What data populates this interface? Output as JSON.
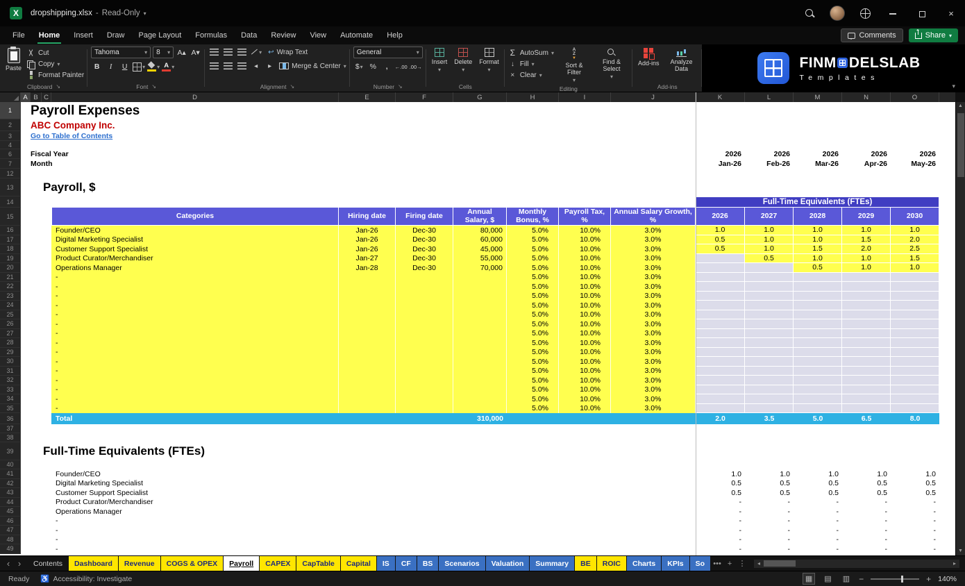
{
  "titlebar": {
    "filename": "dropshipping.xlsx",
    "separator": "-",
    "mode": "Read-Only"
  },
  "menubar": {
    "items": [
      "File",
      "Home",
      "Insert",
      "Draw",
      "Page Layout",
      "Formulas",
      "Data",
      "Review",
      "View",
      "Automate",
      "Help"
    ],
    "active_index": 1,
    "comments_label": "Comments",
    "share_label": "Share"
  },
  "ribbon": {
    "clipboard": {
      "label": "Clipboard",
      "paste": "Paste",
      "cut": "Cut",
      "copy": "Copy",
      "format_painter": "Format Painter"
    },
    "font": {
      "label": "Font",
      "name": "Tahoma",
      "size": "8",
      "bold": "B",
      "italic": "I",
      "underline": "U",
      "grow": "A▴",
      "shrink": "A▾"
    },
    "alignment": {
      "label": "Alignment",
      "wrap_text": "Wrap Text",
      "merge_center": "Merge & Center"
    },
    "number": {
      "label": "Number",
      "format": "General",
      "currency": "$",
      "percent": "%",
      "comma": ",",
      "inc_decimal": "←.00",
      "dec_decimal": ".00→"
    },
    "cells": {
      "label": "Cells",
      "insert": "Insert",
      "delete": "Delete",
      "format": "Format"
    },
    "editing": {
      "label": "Editing",
      "autosum": "AutoSum",
      "fill": "Fill",
      "clear": "Clear",
      "sort_filter": "Sort & Filter",
      "find_select": "Find & Select"
    },
    "addins": {
      "label": "Add-ins",
      "addins_btn": "Add-ins",
      "analyze": "Analyze Data"
    },
    "brand": {
      "pre": "FINM",
      "post": "DELSLAB",
      "subtitle": "Templates"
    }
  },
  "grid": {
    "column_letters": [
      "A",
      "B",
      "C",
      "D",
      "E",
      "F",
      "G",
      "H",
      "I",
      "J",
      "K",
      "L",
      "M",
      "N",
      "O"
    ],
    "visible_row_numbers": [
      "1",
      "2",
      "3",
      "4",
      "6",
      "7",
      "12",
      "13",
      "14",
      "15",
      "16",
      "17",
      "18",
      "19",
      "20",
      "21",
      "22",
      "23",
      "24",
      "25",
      "26",
      "27",
      "28",
      "29",
      "30",
      "31",
      "32",
      "33",
      "34",
      "35",
      "36",
      "37",
      "38",
      "39",
      "40",
      "41",
      "42",
      "43",
      "44",
      "45",
      "46",
      "47",
      "48",
      "49"
    ],
    "title": "Payroll Expenses",
    "company": "ABC Company Inc.",
    "toc_link": "Go to Table of Contents",
    "fiscal_year_label": "Fiscal Year",
    "month_label": "Month",
    "fiscal_years": [
      "2026",
      "2026",
      "2026",
      "2026",
      "2026"
    ],
    "months": [
      "Jan-26",
      "Feb-26",
      "Mar-26",
      "Apr-26",
      "May-26"
    ],
    "payroll_section_title": "Payroll, $",
    "fte_banner": "Full-Time Equivalents (FTEs)",
    "table": {
      "headers": {
        "categories": "Categories",
        "hiring": "Hiring date",
        "firing": "Firing date",
        "salary": "Annual Salary, $",
        "bonus": "Monthly Bonus, %",
        "tax": "Payroll Tax, %",
        "growth": "Annual Salary Growth, %",
        "years": [
          "2026",
          "2027",
          "2028",
          "2029",
          "2030"
        ]
      },
      "rows": [
        {
          "category": "Founder/CEO",
          "hiring": "Jan-26",
          "firing": "Dec-30",
          "salary": "80,000",
          "bonus": "5.0%",
          "tax": "10.0%",
          "growth": "3.0%",
          "ftes": [
            "1.0",
            "1.0",
            "1.0",
            "1.0",
            "1.0"
          ]
        },
        {
          "category": "Digital Marketing Specialist",
          "hiring": "Jan-26",
          "firing": "Dec-30",
          "salary": "60,000",
          "bonus": "5.0%",
          "tax": "10.0%",
          "growth": "3.0%",
          "ftes": [
            "0.5",
            "1.0",
            "1.0",
            "1.5",
            "2.0"
          ]
        },
        {
          "category": "Customer Support Specialist",
          "hiring": "Jan-26",
          "firing": "Dec-30",
          "salary": "45,000",
          "bonus": "5.0%",
          "tax": "10.0%",
          "growth": "3.0%",
          "ftes": [
            "0.5",
            "1.0",
            "1.5",
            "2.0",
            "2.5"
          ]
        },
        {
          "category": "Product Curator/Merchandiser",
          "hiring": "Jan-27",
          "firing": "Dec-30",
          "salary": "55,000",
          "bonus": "5.0%",
          "tax": "10.0%",
          "growth": "3.0%",
          "ftes": [
            "",
            "0.5",
            "1.0",
            "1.0",
            "1.5"
          ]
        },
        {
          "category": "Operations Manager",
          "hiring": "Jan-28",
          "firing": "Dec-30",
          "salary": "70,000",
          "bonus": "5.0%",
          "tax": "10.0%",
          "growth": "3.0%",
          "ftes": [
            "",
            "",
            "0.5",
            "1.0",
            "1.0"
          ]
        },
        {
          "category": "-",
          "hiring": "",
          "firing": "",
          "salary": "",
          "bonus": "5.0%",
          "tax": "10.0%",
          "growth": "3.0%",
          "ftes": [
            "",
            "",
            "",
            "",
            ""
          ]
        },
        {
          "category": "-",
          "hiring": "",
          "firing": "",
          "salary": "",
          "bonus": "5.0%",
          "tax": "10.0%",
          "growth": "3.0%",
          "ftes": [
            "",
            "",
            "",
            "",
            ""
          ]
        },
        {
          "category": "-",
          "hiring": "",
          "firing": "",
          "salary": "",
          "bonus": "5.0%",
          "tax": "10.0%",
          "growth": "3.0%",
          "ftes": [
            "",
            "",
            "",
            "",
            ""
          ]
        },
        {
          "category": "-",
          "hiring": "",
          "firing": "",
          "salary": "",
          "bonus": "5.0%",
          "tax": "10.0%",
          "growth": "3.0%",
          "ftes": [
            "",
            "",
            "",
            "",
            ""
          ]
        },
        {
          "category": "-",
          "hiring": "",
          "firing": "",
          "salary": "",
          "bonus": "5.0%",
          "tax": "10.0%",
          "growth": "3.0%",
          "ftes": [
            "",
            "",
            "",
            "",
            ""
          ]
        },
        {
          "category": "-",
          "hiring": "",
          "firing": "",
          "salary": "",
          "bonus": "5.0%",
          "tax": "10.0%",
          "growth": "3.0%",
          "ftes": [
            "",
            "",
            "",
            "",
            ""
          ]
        },
        {
          "category": "-",
          "hiring": "",
          "firing": "",
          "salary": "",
          "bonus": "5.0%",
          "tax": "10.0%",
          "growth": "3.0%",
          "ftes": [
            "",
            "",
            "",
            "",
            ""
          ]
        },
        {
          "category": "-",
          "hiring": "",
          "firing": "",
          "salary": "",
          "bonus": "5.0%",
          "tax": "10.0%",
          "growth": "3.0%",
          "ftes": [
            "",
            "",
            "",
            "",
            ""
          ]
        },
        {
          "category": "-",
          "hiring": "",
          "firing": "",
          "salary": "",
          "bonus": "5.0%",
          "tax": "10.0%",
          "growth": "3.0%",
          "ftes": [
            "",
            "",
            "",
            "",
            ""
          ]
        },
        {
          "category": "-",
          "hiring": "",
          "firing": "",
          "salary": "",
          "bonus": "5.0%",
          "tax": "10.0%",
          "growth": "3.0%",
          "ftes": [
            "",
            "",
            "",
            "",
            ""
          ]
        },
        {
          "category": "-",
          "hiring": "",
          "firing": "",
          "salary": "",
          "bonus": "5.0%",
          "tax": "10.0%",
          "growth": "3.0%",
          "ftes": [
            "",
            "",
            "",
            "",
            ""
          ]
        },
        {
          "category": "-",
          "hiring": "",
          "firing": "",
          "salary": "",
          "bonus": "5.0%",
          "tax": "10.0%",
          "growth": "3.0%",
          "ftes": [
            "",
            "",
            "",
            "",
            ""
          ]
        },
        {
          "category": "-",
          "hiring": "",
          "firing": "",
          "salary": "",
          "bonus": "5.0%",
          "tax": "10.0%",
          "growth": "3.0%",
          "ftes": [
            "",
            "",
            "",
            "",
            ""
          ]
        },
        {
          "category": "-",
          "hiring": "",
          "firing": "",
          "salary": "",
          "bonus": "5.0%",
          "tax": "10.0%",
          "growth": "3.0%",
          "ftes": [
            "",
            "",
            "",
            "",
            ""
          ]
        },
        {
          "category": "-",
          "hiring": "",
          "firing": "",
          "salary": "",
          "bonus": "5.0%",
          "tax": "10.0%",
          "growth": "3.0%",
          "ftes": [
            "",
            "",
            "",
            "",
            ""
          ]
        }
      ],
      "total": {
        "label": "Total",
        "salary": "310,000",
        "ftes": [
          "2.0",
          "3.5",
          "5.0",
          "6.5",
          "8.0"
        ]
      }
    },
    "fte_section": {
      "title": "Full-Time Equivalents (FTEs)",
      "rows": [
        {
          "label": "Founder/CEO",
          "values": [
            "1.0",
            "1.0",
            "1.0",
            "1.0",
            "1.0"
          ]
        },
        {
          "label": "Digital Marketing Specialist",
          "values": [
            "0.5",
            "0.5",
            "0.5",
            "0.5",
            "0.5"
          ]
        },
        {
          "label": "Customer Support Specialist",
          "values": [
            "0.5",
            "0.5",
            "0.5",
            "0.5",
            "0.5"
          ]
        },
        {
          "label": "Product Curator/Merchandiser",
          "values": [
            "-",
            "-",
            "-",
            "-",
            "-"
          ]
        },
        {
          "label": "Operations Manager",
          "values": [
            "-",
            "-",
            "-",
            "-",
            "-"
          ]
        },
        {
          "label": "-",
          "values": [
            "-",
            "-",
            "-",
            "-",
            "-"
          ]
        },
        {
          "label": "-",
          "values": [
            "-",
            "-",
            "-",
            "-",
            "-"
          ]
        },
        {
          "label": "-",
          "values": [
            "-",
            "-",
            "-",
            "-",
            "-"
          ]
        },
        {
          "label": "-",
          "values": [
            "-",
            "-",
            "-",
            "-",
            "-"
          ]
        }
      ]
    }
  },
  "sheet_tabs": {
    "tabs": [
      {
        "label": "Contents",
        "color": "plain"
      },
      {
        "label": "Dashboard",
        "color": "yellow"
      },
      {
        "label": "Revenue",
        "color": "yellow"
      },
      {
        "label": "COGS & OPEX",
        "color": "yellow"
      },
      {
        "label": "Payroll",
        "color": "active"
      },
      {
        "label": "CAPEX",
        "color": "yellow"
      },
      {
        "label": "CapTable",
        "color": "yellow"
      },
      {
        "label": "Capital",
        "color": "yellow"
      },
      {
        "label": "IS",
        "color": "blue"
      },
      {
        "label": "CF",
        "color": "blue"
      },
      {
        "label": "BS",
        "color": "blue"
      },
      {
        "label": "Scenarios",
        "color": "blue"
      },
      {
        "label": "Valuation",
        "color": "blue"
      },
      {
        "label": "Summary",
        "color": "blue"
      },
      {
        "label": "BE",
        "color": "yellow"
      },
      {
        "label": "ROIC",
        "color": "yellow"
      },
      {
        "label": "Charts",
        "color": "blue"
      },
      {
        "label": "KPIs",
        "color": "blue"
      },
      {
        "label": "So",
        "color": "blue"
      }
    ]
  },
  "statusbar": {
    "ready": "Ready",
    "accessibility": "Accessibility: Investigate",
    "zoom": "140%"
  },
  "colors": {
    "table_header": "#5a58d8",
    "fte_banner": "#403dc2",
    "cell_yellow": "#ffff4f",
    "total_cyan": "#2eb1e3",
    "empty_cell": "#dcdcea",
    "company_red": "#c00000",
    "link_blue": "#2d6fce",
    "tab_yellow": "#ffe600",
    "tab_blue": "#3a70c2",
    "share_green": "#107c41"
  }
}
